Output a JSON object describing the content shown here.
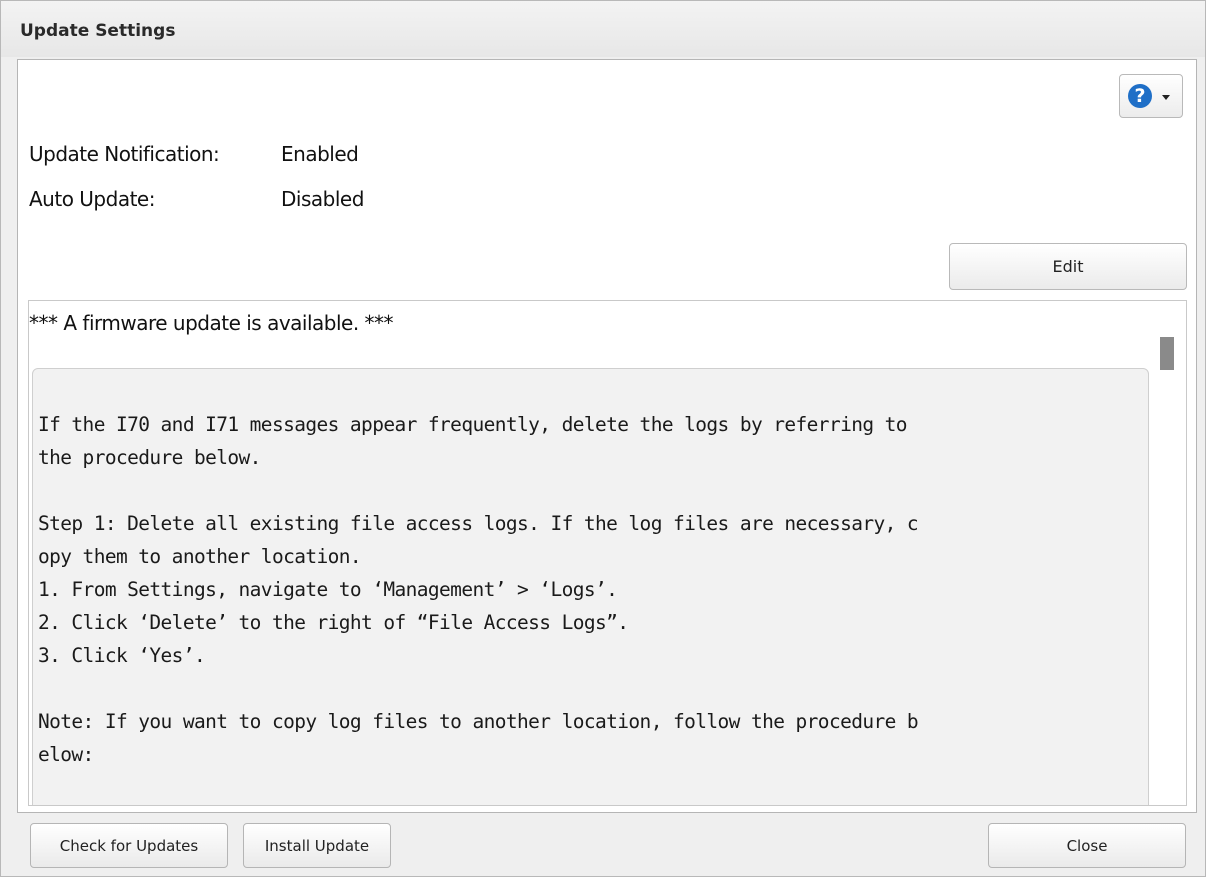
{
  "dialog": {
    "title": "Update Settings"
  },
  "help": {
    "icon": "help-icon",
    "glyph": "?",
    "accent": "#1f6fc7"
  },
  "settings": {
    "rows": [
      {
        "label": "Update Notification:",
        "value": "Enabled"
      },
      {
        "label": "Auto Update:",
        "value": "Disabled"
      }
    ],
    "edit_label": "Edit"
  },
  "log": {
    "notice": "*** A firmware update is available. ***",
    "body": "If the I70 and I71 messages appear frequently, delete the logs by referring to\nthe procedure below.\n\nStep 1: Delete all existing file access logs. If the log files are necessary, c\nopy them to another location.\n1. From Settings, navigate to ‘Management’ > ‘Logs’.\n2. Click ‘Delete’ to the right of “File Access Logs”.\n3. Click ‘Yes’.\n\nNote: If you want to copy log files to another location, follow the procedure b\nelow:"
  },
  "footer": {
    "check_label": "Check for Updates",
    "install_label": "Install Update",
    "close_label": "Close"
  }
}
